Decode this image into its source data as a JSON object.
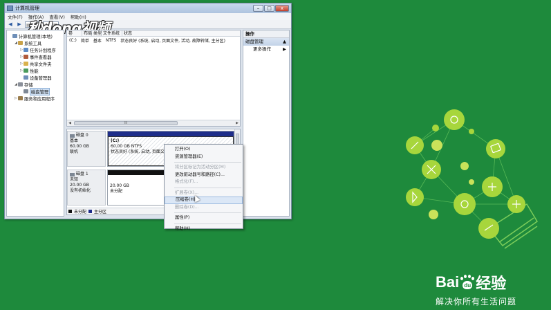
{
  "window": {
    "title": "计算机管理",
    "buttons": {
      "minimize": "–",
      "maximize": "□",
      "close": "x"
    }
  },
  "menu": [
    "文件(F)",
    "操作(A)",
    "查看(V)",
    "帮助(H)"
  ],
  "watermark": "秒dong视频",
  "tree": [
    {
      "label": "计算机管理(本地)",
      "level": 0,
      "arrow": "",
      "icon_color": "#6f8fb8"
    },
    {
      "label": "系统工具",
      "level": 1,
      "arrow": "◢",
      "icon_color": "#c9a24a"
    },
    {
      "label": "任务计划程序",
      "level": 2,
      "arrow": "▷",
      "icon_color": "#5c8bc6"
    },
    {
      "label": "事件查看器",
      "level": 2,
      "arrow": "▷",
      "icon_color": "#b05a3b"
    },
    {
      "label": "共享文件夹",
      "level": 2,
      "arrow": "▷",
      "icon_color": "#d9b24c"
    },
    {
      "label": "性能",
      "level": 2,
      "arrow": "▷",
      "icon_color": "#4a9b5c"
    },
    {
      "label": "设备管理器",
      "level": 2,
      "arrow": "",
      "icon_color": "#6f8fb8"
    },
    {
      "label": "存储",
      "level": 1,
      "arrow": "◢",
      "icon_color": "#8a8f99"
    },
    {
      "label": "磁盘管理",
      "level": 2,
      "arrow": "",
      "icon_color": "#7d8794",
      "selected": true
    },
    {
      "label": "服务和应用程序",
      "level": 1,
      "arrow": "▷",
      "icon_color": "#9a7c4b"
    }
  ],
  "volume_list": {
    "headers": [
      "卷",
      "布局",
      "类型",
      "文件系统",
      "状态"
    ],
    "rows": [
      {
        "vol": "(C:)",
        "layout": "简单",
        "type": "基本",
        "fs": "NTFS",
        "status": "状态良好 (系统, 启动, 页面文件, 活动, 故障转储, 主分区)"
      }
    ],
    "scroll_thumb": "III"
  },
  "disks": [
    {
      "name": "磁盘 0",
      "type": "基本",
      "size": "60.00 GB",
      "state": "联机",
      "partition": {
        "title": "(C:)",
        "size": "60.00 GB NTFS",
        "status": "状态良好 (系统, 启动, 页面文件, 活动, 故障转储, 主分区)",
        "band_color": "#1e2d8a"
      }
    },
    {
      "name": "磁盘 1",
      "type": "未知",
      "size": "20.00 GB",
      "state": "没有初始化",
      "partition": {
        "title": "",
        "size": "20.00 GB",
        "status": "未分配",
        "band_color": "#111111"
      }
    }
  ],
  "legend": [
    {
      "label": "未分配",
      "color": "#111111"
    },
    {
      "label": "主分区",
      "color": "#1e2d8a"
    }
  ],
  "actions": {
    "header": "操作",
    "section": "磁盘管理",
    "item": "更多操作"
  },
  "context_menu": [
    {
      "label": "打开(O)",
      "disabled": false
    },
    {
      "label": "资源管理器(E)",
      "disabled": false
    },
    {
      "sep": true
    },
    {
      "label": "将分区标记为活动分区(M)",
      "disabled": true
    },
    {
      "label": "更改驱动器号和路径(C)...",
      "disabled": false
    },
    {
      "label": "格式化(F)...",
      "disabled": true
    },
    {
      "sep": true
    },
    {
      "label": "扩展卷(X)...",
      "disabled": true
    },
    {
      "label": "压缩卷(H)...",
      "disabled": false,
      "highlighted": true
    },
    {
      "label": "删除卷(D)...",
      "disabled": true
    },
    {
      "sep": true
    },
    {
      "label": "属性(P)",
      "disabled": false
    },
    {
      "sep": true
    },
    {
      "label": "帮助(H)",
      "disabled": false
    }
  ],
  "branding": {
    "logo_left": "Bai",
    "logo_paw": "du",
    "logo_right": "经验",
    "slogan": "解决你所有生活问题",
    "bg_color": "#1e8a3c"
  }
}
